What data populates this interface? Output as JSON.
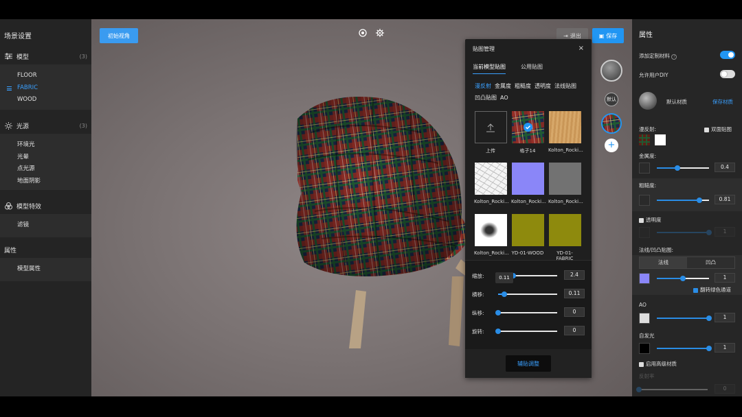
{
  "left": {
    "title": "场景设置",
    "sections": {
      "model": {
        "label": "模型",
        "count": "(3)",
        "items": [
          "FLOOR",
          "FABRIC",
          "WOOD"
        ]
      },
      "light": {
        "label": "光源",
        "count": "(3)",
        "items": [
          "环境光",
          "光晕",
          "点光源",
          "地面阴影"
        ]
      },
      "effect": {
        "label": "模型特效",
        "items": [
          "滤镜"
        ]
      },
      "props": {
        "label": "属性",
        "items": [
          "模型属性"
        ]
      }
    }
  },
  "viewport": {
    "init_view": "初始视角",
    "exit": "退出",
    "save": "保存",
    "default_label": "默认"
  },
  "texmgr": {
    "title": "贴图管理",
    "close": "×",
    "tabs": [
      "当前模型贴图",
      "公用贴图"
    ],
    "channels": [
      "漫反射",
      "金属度",
      "粗糙度",
      "透明度",
      "法线贴图",
      "凹凸贴图",
      "AO"
    ],
    "thumbs": [
      "上传",
      "格子14",
      "Kolton_Rocki...",
      "Kolton_Rocki...",
      "Kolton_Rocki...",
      "Kolton_Rocki...",
      "Kolton_Rocki...",
      "YD-01-WOOD",
      "YD-01-FABRIC"
    ],
    "sliders": [
      {
        "label": "缩放:",
        "value": "2.4",
        "fraction": 0.25
      },
      {
        "label": "横移:",
        "value": "0.11",
        "fraction": 0.11
      },
      {
        "label": "纵移:",
        "value": "0",
        "fraction": 0
      },
      {
        "label": "旋转:",
        "value": "0",
        "fraction": 0
      }
    ],
    "tooltip": "0.11",
    "footer_button": "辅贴调整"
  },
  "right": {
    "title": "属性",
    "add_custom": "添加定制材料",
    "allow_diy": "允许用户DIY",
    "material_name": "默认材质",
    "save_material": "保存材质",
    "diffuse": "漫反射:",
    "double_sided": "双面贴图",
    "metalness": {
      "label": "金属度:",
      "value": "0.4",
      "fraction": 0.4
    },
    "roughness": {
      "label": "粗糙度:",
      "value": "0.81",
      "fraction": 0.81
    },
    "opacity": {
      "label": "透明度",
      "value": "1",
      "fraction": 1
    },
    "normal": {
      "label": "法线/凹凸贴图:",
      "tabs": [
        "法线",
        "凹凸"
      ],
      "value": "1",
      "fraction": 0.5
    },
    "flip_green": "翻转绿色通道",
    "ao": {
      "label": "AO",
      "value": "1",
      "fraction": 1
    },
    "emissive": {
      "label": "自发光",
      "value": "1",
      "fraction": 1
    },
    "advanced": "启用高级材质",
    "reflect": {
      "label": "反射率",
      "value": "0",
      "fraction": 0
    },
    "accent": "#2196f3"
  }
}
